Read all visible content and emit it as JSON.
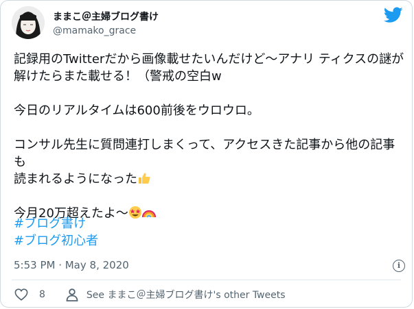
{
  "tweet": {
    "author_name": "ままこ＠主婦ブログ書け",
    "author_handle": "@mamako_grace",
    "lines": [
      "記録用のTwitterだから画像載せたいんだけど〜アナリ ティクスの謎が",
      "解けたらまた載せる！（警戒の空白w",
      "",
      "今日のリアルタイムは600前後をウロウロ。",
      "",
      "コンサル先生に質問連打しまくって、アクセスきた記事から他の記事も",
      "読まれるようになった",
      "",
      "今月20万超えたよ〜"
    ],
    "hashtags": [
      "#ブログ書け",
      "#ブログ初心者"
    ],
    "timestamp": "5:53 PM · May 8, 2020",
    "like_count": "8",
    "see_more": "See ままこ＠主婦ブログ書け's other Tweets"
  },
  "icons": {
    "brand": "twitter-bird-icon",
    "info": "info-icon",
    "like": "heart-icon",
    "profile": "person-icon",
    "emoji_1": "thumbs-up-emoji",
    "emoji_2": "star-struck-emoji",
    "emoji_3": "rainbow-emoji"
  },
  "colors": {
    "accent": "#1d9bf0",
    "muted": "#536471",
    "text": "#0f1419",
    "border": "#cfd9de"
  }
}
